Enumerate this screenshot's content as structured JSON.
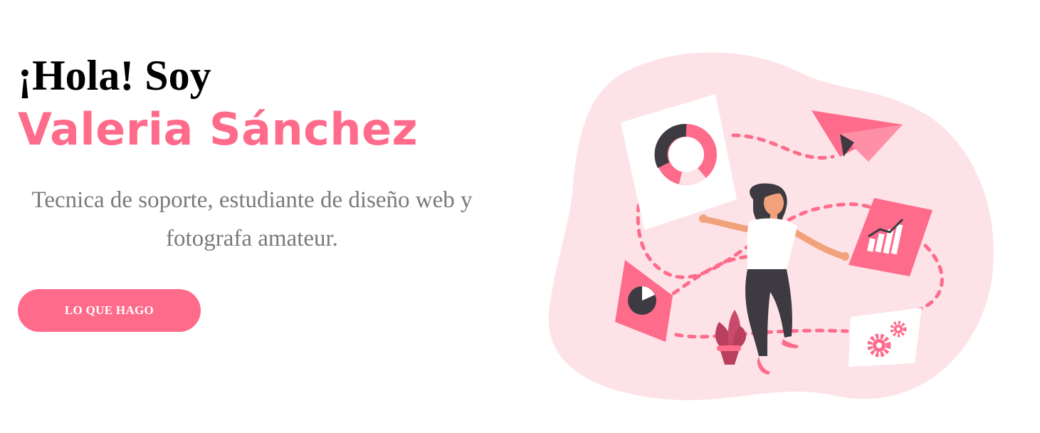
{
  "hero": {
    "greeting": "¡Hola! Soy",
    "name": "Valeria Sánchez",
    "tagline": "Tecnica de soporte, estudiante de diseño web y fotografa amateur.",
    "cta_label": "LO QUE HAGO"
  },
  "colors": {
    "accent": "#ff6b8a",
    "blob_bg": "#fde3e8",
    "dark": "#3d3a42",
    "text_muted": "#7a7a7a"
  },
  "illustration": {
    "icons": [
      "donut-chart-card-icon",
      "paper-plane-icon",
      "bar-chart-card-icon",
      "pie-chart-card-icon",
      "gears-card-icon",
      "potted-plant-icon",
      "woman-figure"
    ]
  }
}
